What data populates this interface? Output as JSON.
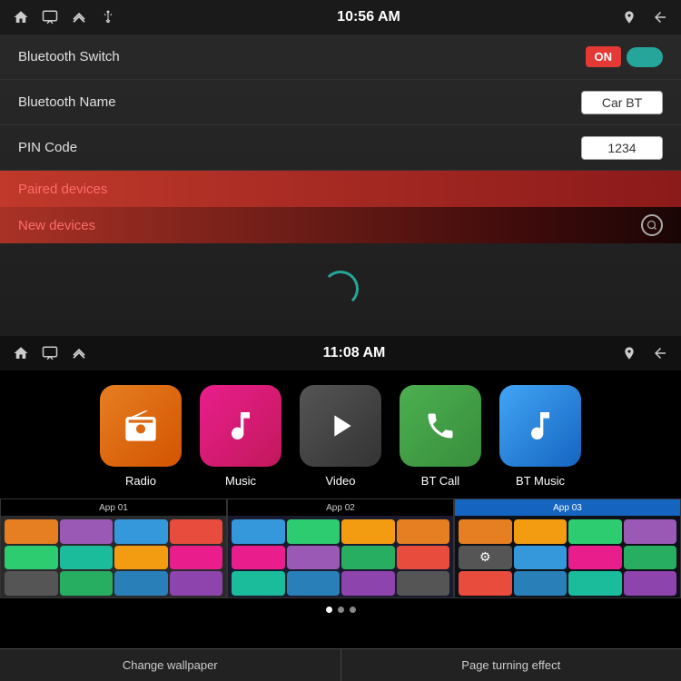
{
  "topPanel": {
    "statusBar": {
      "time": "10:56 AM",
      "icons": [
        "home",
        "screen",
        "double-up",
        "usb",
        "location",
        "back"
      ]
    },
    "bluetoothSwitch": {
      "label": "Bluetooth Switch",
      "toggleOn": "ON"
    },
    "bluetoothName": {
      "label": "Bluetooth Name",
      "value": "Car BT"
    },
    "pinCode": {
      "label": "PIN Code",
      "value": "1234"
    },
    "pairedDevices": {
      "label": "Paired devices"
    },
    "newDevices": {
      "label": "New devices"
    }
  },
  "bottomPanel": {
    "statusBar": {
      "time": "11:08 AM",
      "icons": [
        "home",
        "screen",
        "double-up",
        "location",
        "back"
      ]
    },
    "apps": [
      {
        "id": "radio",
        "label": "Radio",
        "icon": "📻"
      },
      {
        "id": "music",
        "label": "Music",
        "icon": "♪"
      },
      {
        "id": "video",
        "label": "Video",
        "icon": "▶"
      },
      {
        "id": "btcall",
        "label": "BT Call",
        "icon": "📞"
      },
      {
        "id": "btmusic",
        "label": "BT Music",
        "icon": "♫"
      }
    ],
    "thumbnails": [
      {
        "id": "app01",
        "label": "App 01",
        "active": false
      },
      {
        "id": "app02",
        "label": "App 02",
        "active": false
      },
      {
        "id": "app03",
        "label": "App 03",
        "active": true
      }
    ],
    "dots": [
      true,
      false,
      false
    ],
    "actionBar": {
      "changeWallpaper": "Change wallpaper",
      "pageTurningEffect": "Page turning effect"
    }
  }
}
